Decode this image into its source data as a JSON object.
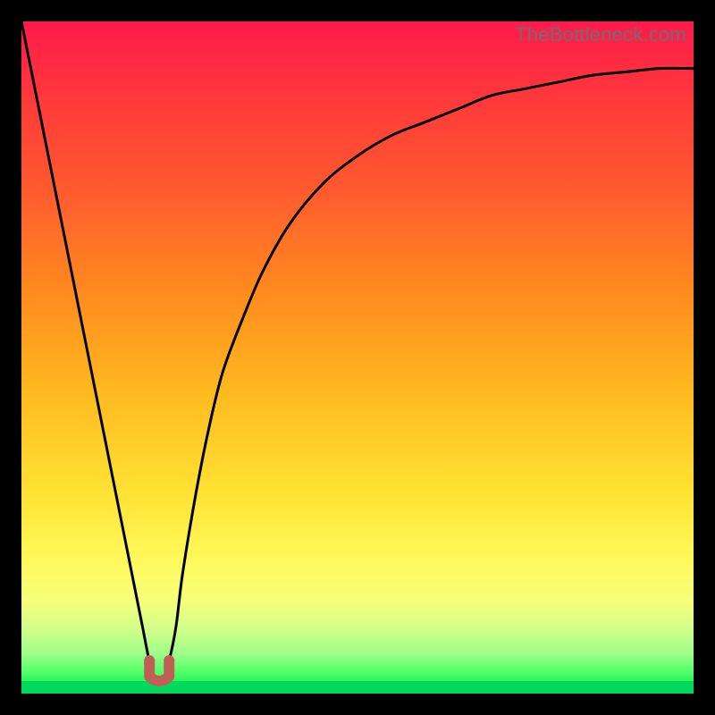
{
  "watermark": "TheBottleneck.com",
  "colors": {
    "frame": "#000000",
    "gradient_top": "#ff1a4d",
    "gradient_bottom": "#00e05a",
    "curve": "#000000",
    "marker": "#c06055"
  },
  "chart_data": {
    "type": "line",
    "title": "",
    "xlabel": "",
    "ylabel": "",
    "xlim": [
      0,
      100
    ],
    "ylim": [
      0,
      100
    ],
    "x": [
      0,
      2,
      4,
      6,
      8,
      10,
      12,
      14,
      16,
      18,
      19,
      20,
      21,
      22,
      23,
      24,
      26,
      28,
      30,
      33,
      36,
      40,
      45,
      50,
      55,
      60,
      65,
      70,
      75,
      80,
      85,
      90,
      95,
      100
    ],
    "y": [
      100,
      90,
      80,
      70,
      60,
      50,
      40,
      30,
      20,
      10,
      5,
      2,
      2,
      5,
      10,
      18,
      30,
      40,
      48,
      56,
      63,
      70,
      76,
      80,
      83,
      85,
      87,
      89,
      90,
      91,
      92,
      92.5,
      93,
      93
    ],
    "marker": {
      "x": 20.5,
      "y": 2,
      "shape": "u",
      "color": "#c06055"
    },
    "notes": "V-shaped bottleneck curve with sharp minimum near x≈20; right branch rises asymptotically toward ~93."
  }
}
